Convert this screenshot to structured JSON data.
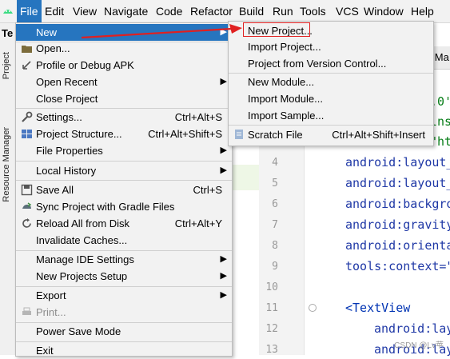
{
  "menubar": {
    "items": [
      "File",
      "Edit",
      "View",
      "Navigate",
      "Code",
      "Refactor",
      "Build",
      "Run",
      "Tools",
      "VCS",
      "Window",
      "Help"
    ]
  },
  "toolstrip": {
    "project_tab": "Project",
    "resource_tab": "Resource Manager"
  },
  "editor": {
    "tab_fragment": "Te",
    "tab_fragment2": "ilMa",
    "line_numbers": [
      "4",
      "5",
      "6",
      "7",
      "8",
      "9",
      "10",
      "11",
      "12",
      "13"
    ],
    "code_lines": [
      ".0'",
      "lns",
      "\"ht",
      "android:layout_",
      "android:layout_",
      "android:backgro",
      "android:gravity",
      "android:orienta",
      "tools:context=\"",
      "<TextView",
      "android:lay",
      "android:lay"
    ]
  },
  "file_menu": {
    "new": "New",
    "open": "Open...",
    "profile": "Profile or Debug APK",
    "open_recent": "Open Recent",
    "close_project": "Close Project",
    "settings": "Settings...",
    "settings_sc": "Ctrl+Alt+S",
    "project_structure": "Project Structure...",
    "project_structure_sc": "Ctrl+Alt+Shift+S",
    "file_properties": "File Properties",
    "local_history": "Local History",
    "save_all": "Save All",
    "save_all_sc": "Ctrl+S",
    "sync": "Sync Project with Gradle Files",
    "reload": "Reload All from Disk",
    "reload_sc": "Ctrl+Alt+Y",
    "invalidate": "Invalidate Caches...",
    "manage_ide": "Manage IDE Settings",
    "new_projects_setup": "New Projects Setup",
    "export": "Export",
    "print": "Print...",
    "power_save": "Power Save Mode",
    "exit": "Exit"
  },
  "new_submenu": {
    "new_project": "New Project...",
    "import_project": "Import Project...",
    "project_from_vcs": "Project from Version Control...",
    "new_module": "New Module...",
    "import_module": "Import Module...",
    "import_sample": "Import Sample...",
    "scratch_file": "Scratch File",
    "scratch_file_sc": "Ctrl+Alt+Shift+Insert"
  },
  "watermark": "CSDN @Lv苹",
  "colors": {
    "selection": "#2675bf",
    "annotation": "#e02020",
    "android": "#3ddc84"
  }
}
